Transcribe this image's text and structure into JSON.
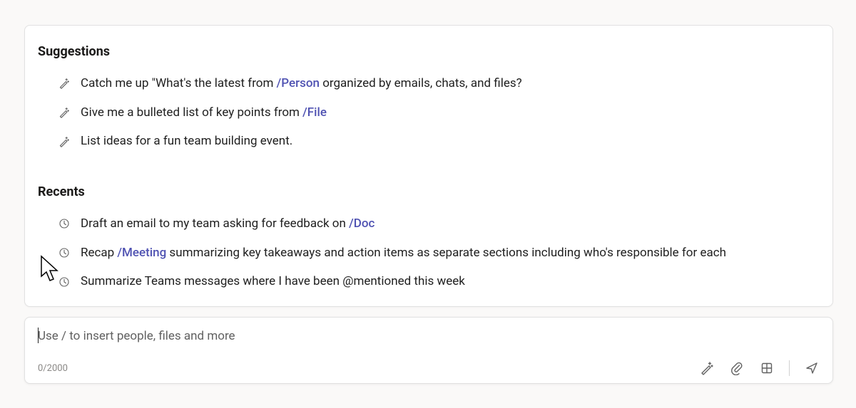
{
  "suggestions": {
    "heading": "Suggestions",
    "items": [
      {
        "segments": [
          {
            "text": "Catch me up \"What's the latest from ",
            "token": false
          },
          {
            "text": "/Person",
            "token": true
          },
          {
            "text": " organized by emails, chats, and files?",
            "token": false
          }
        ]
      },
      {
        "segments": [
          {
            "text": "Give me a bulleted list of key points from ",
            "token": false
          },
          {
            "text": "/File",
            "token": true
          }
        ]
      },
      {
        "segments": [
          {
            "text": "List ideas for a fun team building event.",
            "token": false
          }
        ]
      }
    ]
  },
  "recents": {
    "heading": "Recents",
    "items": [
      {
        "segments": [
          {
            "text": "Draft an email to my team asking for feedback on ",
            "token": false
          },
          {
            "text": "/Doc",
            "token": true
          }
        ]
      },
      {
        "segments": [
          {
            "text": "Recap ",
            "token": false
          },
          {
            "text": "/Meeting",
            "token": true
          },
          {
            "text": " summarizing key takeaways and action items as separate sections including who's responsible for each",
            "token": false
          }
        ]
      },
      {
        "segments": [
          {
            "text": "Summarize Teams messages where I have been @mentioned this week",
            "token": false
          }
        ]
      }
    ]
  },
  "compose": {
    "placeholder": "Use / to insert people, files and more",
    "value": "",
    "counter": "0/2000"
  },
  "icons": {
    "suggestion": "wand-icon",
    "recent": "clock-icon"
  }
}
